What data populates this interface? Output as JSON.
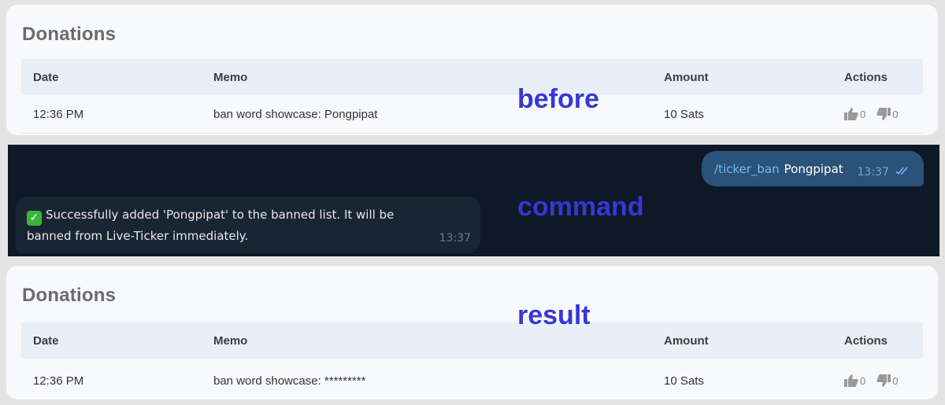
{
  "before_panel": {
    "title": "Donations",
    "columns": [
      "Date",
      "Memo",
      "Amount",
      "Actions"
    ],
    "row": {
      "date": "12:36 PM",
      "memo": "ban word showcase: Pongpipat",
      "amount": "10 Sats",
      "upvotes": "0",
      "downvotes": "0"
    }
  },
  "chat": {
    "outgoing": {
      "command": "/ticker_ban",
      "argument": "Pongpipat",
      "time": "13:37",
      "status_icon": "double-check-icon"
    },
    "incoming": {
      "icon": "check-mark-icon",
      "text": "Successfully added 'Pongpipat' to the banned list. It will be banned from Live-Ticker immediately.",
      "time": "13:37"
    }
  },
  "after_panel": {
    "title": "Donations",
    "columns": [
      "Date",
      "Memo",
      "Amount",
      "Actions"
    ],
    "row": {
      "date": "12:36 PM",
      "memo": "ban word showcase: *********",
      "amount": "10 Sats",
      "upvotes": "0",
      "downvotes": "0"
    }
  },
  "labels": {
    "before": "before",
    "command": "command",
    "result": "result"
  },
  "colors": {
    "label": "#3737d4",
    "chat_bg": "#0f1826",
    "bubble_out": "#2b5278",
    "bubble_in": "#182533",
    "link": "#71b8f5"
  }
}
